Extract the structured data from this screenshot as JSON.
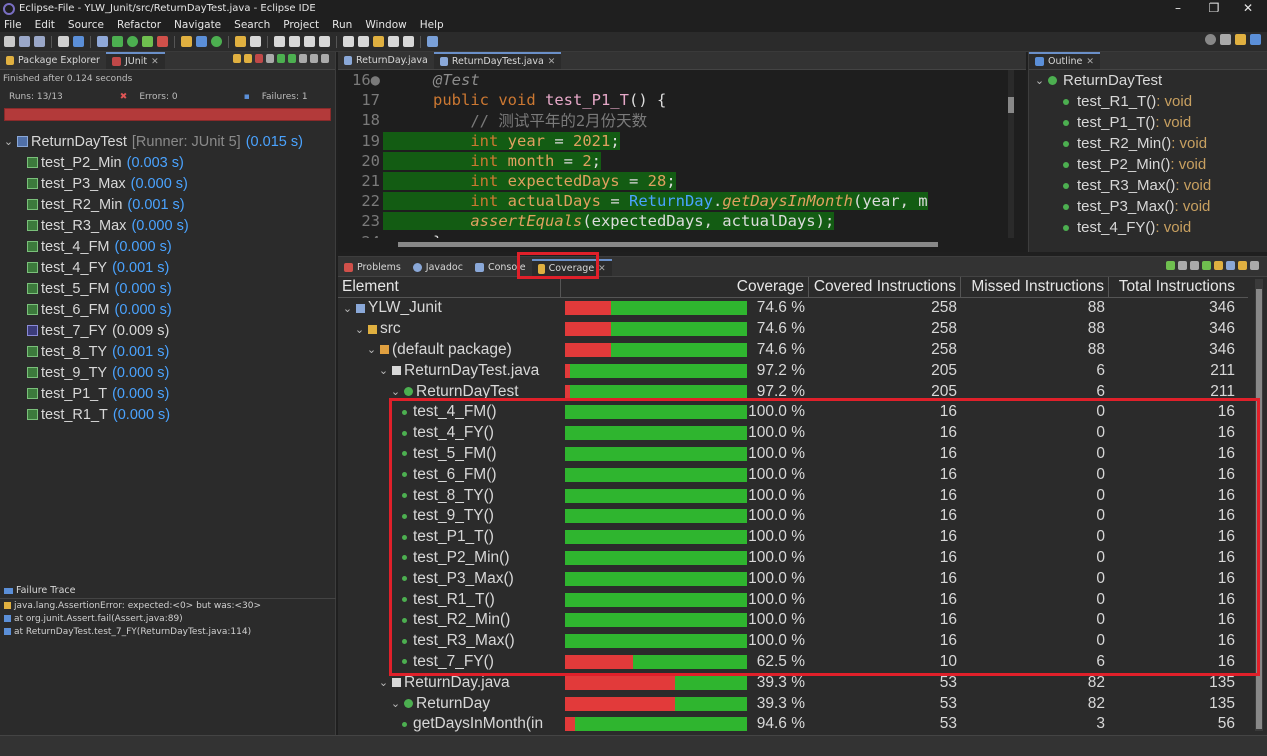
{
  "window": {
    "title": "Eclipse-File - YLW_Junit/src/ReturnDayTest.java - Eclipse IDE",
    "controls": [
      "–",
      "❐",
      "✕"
    ]
  },
  "menu": [
    "File",
    "Edit",
    "Source",
    "Refactor",
    "Navigate",
    "Search",
    "Project",
    "Run",
    "Window",
    "Help"
  ],
  "left_panel": {
    "tabs": [
      {
        "label": "Package Explorer",
        "active": false
      },
      {
        "label": "JUnit",
        "active": true
      }
    ],
    "finished": "Finished after 0.124 seconds",
    "runs": "Runs: 13/13",
    "errors": "Errors: 0",
    "failures": "Failures: 1",
    "root": {
      "name": "ReturnDayTest",
      "runner": "[Runner: JUnit 5]",
      "time": "(0.015 s)"
    },
    "tests": [
      {
        "name": "test_P2_Min",
        "time": "(0.003 s)",
        "failed": false
      },
      {
        "name": "test_P3_Max",
        "time": "(0.000 s)",
        "failed": false
      },
      {
        "name": "test_R2_Min",
        "time": "(0.001 s)",
        "failed": false
      },
      {
        "name": "test_R3_Max",
        "time": "(0.000 s)",
        "failed": false
      },
      {
        "name": "test_4_FM",
        "time": "(0.000 s)",
        "failed": false
      },
      {
        "name": "test_4_FY",
        "time": "(0.001 s)",
        "failed": false
      },
      {
        "name": "test_5_FM",
        "time": "(0.000 s)",
        "failed": false
      },
      {
        "name": "test_6_FM",
        "time": "(0.000 s)",
        "failed": false
      },
      {
        "name": "test_7_FY",
        "time": "(0.009 s)",
        "failed": true
      },
      {
        "name": "test_8_TY",
        "time": "(0.001 s)",
        "failed": false
      },
      {
        "name": "test_9_TY",
        "time": "(0.000 s)",
        "failed": false
      },
      {
        "name": "test_P1_T",
        "time": "(0.000 s)",
        "failed": false
      },
      {
        "name": "test_R1_T",
        "time": "(0.000 s)",
        "failed": false
      }
    ],
    "failure_trace": {
      "title": "Failure Trace",
      "lines": [
        "java.lang.AssertionError: expected:<0> but was:<30>",
        "at org.junit.Assert.fail(Assert.java:89)",
        "at ReturnDayTest.test_7_FY(ReturnDayTest.java:114)"
      ]
    }
  },
  "editor": {
    "tabs": [
      {
        "label": "ReturnDay.java",
        "active": false
      },
      {
        "label": "ReturnDayTest.java",
        "active": true
      }
    ],
    "lines": [
      {
        "num": "16●",
        "covered": false,
        "tokens": [
          [
            "k-ann",
            "@Test"
          ]
        ]
      },
      {
        "num": "17",
        "covered": false,
        "tokens": [
          [
            "k-kw",
            "public void "
          ],
          [
            "k-id",
            "test_P1_T"
          ],
          [
            "k-plain",
            "() {"
          ]
        ]
      },
      {
        "num": "18",
        "covered": false,
        "tokens": [
          [
            "k-cm",
            "    // 测试平年的2月份天数"
          ]
        ]
      },
      {
        "num": "19",
        "covered": true,
        "tokens": [
          [
            "k-kw",
            "    int "
          ],
          [
            "k-var",
            "year"
          ],
          [
            "k-plain",
            " = "
          ],
          [
            "k-num",
            "2021"
          ],
          [
            "k-plain",
            ";"
          ]
        ]
      },
      {
        "num": "20",
        "covered": true,
        "tokens": [
          [
            "k-kw",
            "    int "
          ],
          [
            "k-var",
            "month"
          ],
          [
            "k-plain",
            " = "
          ],
          [
            "k-num",
            "2"
          ],
          [
            "k-plain",
            ";"
          ]
        ]
      },
      {
        "num": "21",
        "covered": true,
        "tokens": [
          [
            "k-kw",
            "    int "
          ],
          [
            "k-var",
            "expectedDays"
          ],
          [
            "k-plain",
            " = "
          ],
          [
            "k-num",
            "28"
          ],
          [
            "k-plain",
            ";"
          ]
        ]
      },
      {
        "num": "22",
        "covered": true,
        "tokens": [
          [
            "k-kw",
            "    int "
          ],
          [
            "k-var",
            "actualDays"
          ],
          [
            "k-plain",
            " = "
          ],
          [
            "k-cls",
            "ReturnDay"
          ],
          [
            "k-plain",
            "."
          ],
          [
            "k-meth",
            "getDaysInMonth"
          ],
          [
            "k-plain",
            "(year, m"
          ]
        ]
      },
      {
        "num": "23",
        "covered": true,
        "tokens": [
          [
            "k-meth",
            "    assertEquals"
          ],
          [
            "k-plain",
            "(expectedDays, actualDays);"
          ]
        ]
      },
      {
        "num": "24",
        "covered": false,
        "tokens": [
          [
            "k-plain",
            "}"
          ]
        ]
      }
    ]
  },
  "outline": {
    "tab": "Outline",
    "class_name": "ReturnDayTest",
    "items": [
      {
        "name": "test_R1_T()",
        "ret": " : void"
      },
      {
        "name": "test_P1_T()",
        "ret": " : void"
      },
      {
        "name": "test_R2_Min()",
        "ret": " : void"
      },
      {
        "name": "test_P2_Min()",
        "ret": " : void"
      },
      {
        "name": "test_R3_Max()",
        "ret": " : void"
      },
      {
        "name": "test_P3_Max()",
        "ret": " : void"
      },
      {
        "name": "test_4_FY()",
        "ret": " : void"
      }
    ]
  },
  "bottom_tabs": [
    "Problems",
    "Javadoc",
    "Console",
    "Coverage"
  ],
  "coverage": {
    "columns": [
      "Element",
      "Coverage",
      "Covered Instructions",
      "Missed Instructions",
      "Total Instructions"
    ],
    "rows": [
      {
        "indent": 0,
        "twisty": "⌄",
        "icon": "project",
        "name": "YLW_Junit",
        "pct": 74.6,
        "pct_label": "74.6 %",
        "covered": "258",
        "missed": "88",
        "total": "346"
      },
      {
        "indent": 1,
        "twisty": "⌄",
        "icon": "folder",
        "name": "src",
        "pct": 74.6,
        "pct_label": "74.6 %",
        "covered": "258",
        "missed": "88",
        "total": "346"
      },
      {
        "indent": 2,
        "twisty": "⌄",
        "icon": "package",
        "name": "(default package)",
        "pct": 74.6,
        "pct_label": "74.6 %",
        "covered": "258",
        "missed": "88",
        "total": "346"
      },
      {
        "indent": 3,
        "twisty": "⌄",
        "icon": "file",
        "name": "ReturnDayTest.java",
        "pct": 97.2,
        "pct_label": "97.2 %",
        "covered": "205",
        "missed": "6",
        "total": "211"
      },
      {
        "indent": 4,
        "twisty": "⌄",
        "icon": "class",
        "name": "ReturnDayTest",
        "pct": 97.2,
        "pct_label": "97.2 %",
        "covered": "205",
        "missed": "6",
        "total": "211"
      },
      {
        "indent": 5,
        "twisty": "",
        "icon": "method",
        "name": "test_4_FM()",
        "pct": 100.0,
        "pct_label": "100.0 %",
        "covered": "16",
        "missed": "0",
        "total": "16"
      },
      {
        "indent": 5,
        "twisty": "",
        "icon": "method",
        "name": "test_4_FY()",
        "pct": 100.0,
        "pct_label": "100.0 %",
        "covered": "16",
        "missed": "0",
        "total": "16"
      },
      {
        "indent": 5,
        "twisty": "",
        "icon": "method",
        "name": "test_5_FM()",
        "pct": 100.0,
        "pct_label": "100.0 %",
        "covered": "16",
        "missed": "0",
        "total": "16"
      },
      {
        "indent": 5,
        "twisty": "",
        "icon": "method",
        "name": "test_6_FM()",
        "pct": 100.0,
        "pct_label": "100.0 %",
        "covered": "16",
        "missed": "0",
        "total": "16"
      },
      {
        "indent": 5,
        "twisty": "",
        "icon": "method",
        "name": "test_8_TY()",
        "pct": 100.0,
        "pct_label": "100.0 %",
        "covered": "16",
        "missed": "0",
        "total": "16"
      },
      {
        "indent": 5,
        "twisty": "",
        "icon": "method",
        "name": "test_9_TY()",
        "pct": 100.0,
        "pct_label": "100.0 %",
        "covered": "16",
        "missed": "0",
        "total": "16"
      },
      {
        "indent": 5,
        "twisty": "",
        "icon": "method",
        "name": "test_P1_T()",
        "pct": 100.0,
        "pct_label": "100.0 %",
        "covered": "16",
        "missed": "0",
        "total": "16"
      },
      {
        "indent": 5,
        "twisty": "",
        "icon": "method",
        "name": "test_P2_Min()",
        "pct": 100.0,
        "pct_label": "100.0 %",
        "covered": "16",
        "missed": "0",
        "total": "16"
      },
      {
        "indent": 5,
        "twisty": "",
        "icon": "method",
        "name": "test_P3_Max()",
        "pct": 100.0,
        "pct_label": "100.0 %",
        "covered": "16",
        "missed": "0",
        "total": "16"
      },
      {
        "indent": 5,
        "twisty": "",
        "icon": "method",
        "name": "test_R1_T()",
        "pct": 100.0,
        "pct_label": "100.0 %",
        "covered": "16",
        "missed": "0",
        "total": "16"
      },
      {
        "indent": 5,
        "twisty": "",
        "icon": "method",
        "name": "test_R2_Min()",
        "pct": 100.0,
        "pct_label": "100.0 %",
        "covered": "16",
        "missed": "0",
        "total": "16"
      },
      {
        "indent": 5,
        "twisty": "",
        "icon": "method",
        "name": "test_R3_Max()",
        "pct": 100.0,
        "pct_label": "100.0 %",
        "covered": "16",
        "missed": "0",
        "total": "16"
      },
      {
        "indent": 5,
        "twisty": "",
        "icon": "method",
        "name": "test_7_FY()",
        "pct": 62.5,
        "pct_label": "62.5 %",
        "covered": "10",
        "missed": "6",
        "total": "16"
      },
      {
        "indent": 3,
        "twisty": "⌄",
        "icon": "file",
        "name": "ReturnDay.java",
        "pct": 39.3,
        "pct_label": "39.3 %",
        "covered": "53",
        "missed": "82",
        "total": "135"
      },
      {
        "indent": 4,
        "twisty": "⌄",
        "icon": "class",
        "name": "ReturnDay",
        "pct": 39.3,
        "pct_label": "39.3 %",
        "covered": "53",
        "missed": "82",
        "total": "135"
      },
      {
        "indent": 5,
        "twisty": "",
        "icon": "method",
        "name": "getDaysInMonth(in",
        "pct": 94.6,
        "pct_label": "94.6 %",
        "covered": "53",
        "missed": "3",
        "total": "56"
      }
    ]
  },
  "colors": {
    "covered_green": "#2fb52f",
    "missed_red": "#e23a3a",
    "highlight_red": "#e0202a",
    "link_blue": "#4aa3ff"
  }
}
